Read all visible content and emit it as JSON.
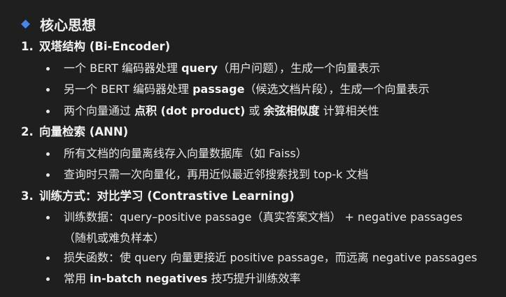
{
  "heading": "核心思想",
  "sections": [
    {
      "number": "1.",
      "title": "双塔结构 (Bi-Encoder)",
      "bullets": [
        {
          "p1": "一个 BERT 编码器处理 ",
          "b1": "query",
          "p2": "（用户问题），生成一个向量表示"
        },
        {
          "p1": "另一个 BERT 编码器处理 ",
          "b1": "passage",
          "p2": "（候选文档片段），生成一个向量表示"
        },
        {
          "p1": "两个向量通过 ",
          "b1": "点积 (dot product)",
          "p2": " 或 ",
          "b2": "余弦相似度",
          "p3": " 计算相关性"
        }
      ]
    },
    {
      "number": "2.",
      "title": "向量检索 (ANN)",
      "bullets": [
        {
          "p1": "所有文档的向量离线存入向量数据库（如 Faiss）"
        },
        {
          "p1": "查询时只需一次向量化，再用近似最近邻搜索找到 top-k 文档"
        }
      ]
    },
    {
      "number": "3.",
      "title": "训练方式：对比学习 (Contrastive Learning)",
      "bullets": [
        {
          "p1": "训练数据：query–positive passage（真实答案文档） + negative passages",
          "cont": "（随机或难负样本）"
        },
        {
          "p1": "损失函数：使 query 向量更接近 positive passage，而远离 negative passages"
        },
        {
          "p1": "常用 ",
          "b1": "in-batch negatives",
          "p2": " 技巧提升训练效率"
        }
      ]
    }
  ]
}
